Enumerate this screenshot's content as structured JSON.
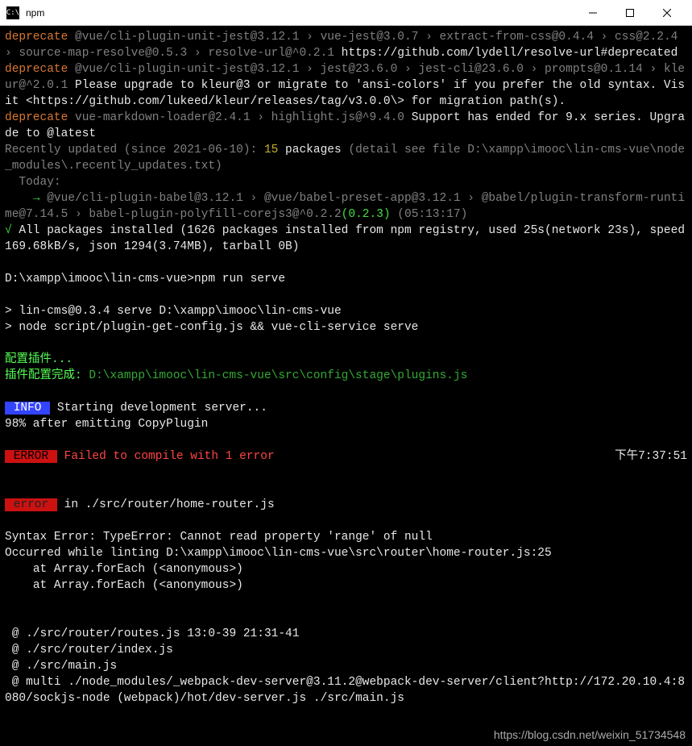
{
  "titlebar": {
    "title": "npm"
  },
  "dep1": {
    "tag": "deprecate",
    "chain": " @vue/cli-plugin-unit-jest@3.12.1 › vue-jest@3.0.7 › extract-from-css@0.4.4 › css@2.2.4 › source-map-resolve@0.5.3 › resolve-url@^0.2.1 ",
    "link": "https://github.com/lydell/resolve-url#deprecated"
  },
  "dep2": {
    "tag": "deprecate",
    "chain": " @vue/cli-plugin-unit-jest@3.12.1 › jest@23.6.0 › jest-cli@23.6.0 › prompts@0.1.14 › kleur@^2.0.1 ",
    "msg": "Please upgrade to kleur@3 or migrate to 'ansi-colors' if you prefer the old syntax. Visit <https://github.com/lukeed/kleur/releases/tag/v3.0.0\\> for migration path(s)."
  },
  "dep3": {
    "tag": "deprecate",
    "chain": " vue-markdown-loader@2.4.1 › highlight.js@^9.4.0 ",
    "msg": "Support has ended for 9.x series. Upgrade to @latest"
  },
  "recent": {
    "prefix": "Recently updated (since 2021-06-10): ",
    "count": "15",
    "mid": " packages ",
    "detail": "(detail see file D:\\xampp\\imooc\\lin-cms-vue\\node_modules\\.recently_updates.txt)",
    "today": "  Today:",
    "line1a": "    → ",
    "line1b": "@vue/cli-plugin-babel@3.12.1 › @vue/babel-preset-app@3.12.1 › @babel/plugin-transform-runtime@7.14.5 › babel-plugin-polyfill-corejs3@^0.2.2",
    "line1ver": "(0.2.3)",
    "line1time": " (05:13:17)"
  },
  "installed": {
    "check": "√ ",
    "msg": "All packages installed (1626 packages installed from npm registry, used 25s(network 23s), speed 169.68kB/s, json 1294(3.74MB), tarball 0B)"
  },
  "prompt": {
    "path": "D:\\xampp\\imooc\\lin-cms-vue>",
    "cmd": "npm run serve"
  },
  "serve": {
    "l1": "> lin-cms@0.3.4 serve D:\\xampp\\imooc\\lin-cms-vue",
    "l2": "> node script/plugin-get-config.js && vue-cli-service serve"
  },
  "plugin": {
    "l1": "配置插件...",
    "l2a": "插件配置完成: ",
    "l2b": "D:\\xampp\\imooc\\lin-cms-vue\\src\\config\\stage\\plugins.js"
  },
  "info": {
    "badge": " INFO ",
    "msg": " Starting development server...",
    "prog": "98% after emitting CopyPlugin"
  },
  "err": {
    "badge": " ERROR ",
    "msg": " Failed to compile with 1 error",
    "time": "下午7:37:51",
    "badge2": " error ",
    "in": " in ./src/router/home-router.js"
  },
  "syntax": {
    "l1": "Syntax Error: TypeError: Cannot read property 'range' of null",
    "l2": "Occurred while linting D:\\xampp\\imooc\\lin-cms-vue\\src\\router\\home-router.js:25",
    "l3": "    at Array.forEach (<anonymous>)",
    "l4": "    at Array.forEach (<anonymous>)"
  },
  "trace": {
    "l1": " @ ./src/router/routes.js 13:0-39 21:31-41",
    "l2": " @ ./src/router/index.js",
    "l3": " @ ./src/main.js",
    "l4": " @ multi ./node_modules/_webpack-dev-server@3.11.2@webpack-dev-server/client?http://172.20.10.4:8080/sockjs-node (webpack)/hot/dev-server.js ./src/main.js"
  },
  "watermark": "https://blog.csdn.net/weixin_51734548"
}
